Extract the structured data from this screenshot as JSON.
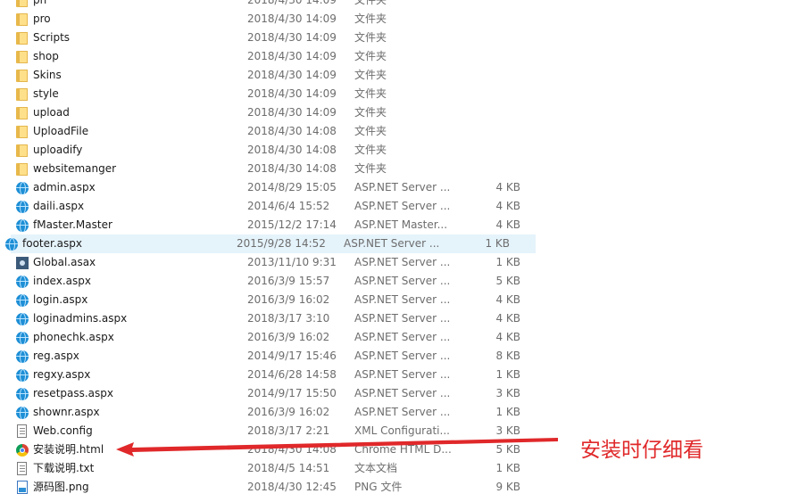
{
  "files": [
    {
      "name": "pn",
      "date": "2018/4/30 14:09",
      "type": "文件夹",
      "size": "",
      "icon": "folder-icon"
    },
    {
      "name": "pro",
      "date": "2018/4/30 14:09",
      "type": "文件夹",
      "size": "",
      "icon": "folder-icon"
    },
    {
      "name": "Scripts",
      "date": "2018/4/30 14:09",
      "type": "文件夹",
      "size": "",
      "icon": "folder-icon"
    },
    {
      "name": "shop",
      "date": "2018/4/30 14:09",
      "type": "文件夹",
      "size": "",
      "icon": "folder-icon"
    },
    {
      "name": "Skins",
      "date": "2018/4/30 14:09",
      "type": "文件夹",
      "size": "",
      "icon": "folder-icon"
    },
    {
      "name": "style",
      "date": "2018/4/30 14:09",
      "type": "文件夹",
      "size": "",
      "icon": "folder-icon"
    },
    {
      "name": "upload",
      "date": "2018/4/30 14:09",
      "type": "文件夹",
      "size": "",
      "icon": "folder-icon"
    },
    {
      "name": "UploadFile",
      "date": "2018/4/30 14:08",
      "type": "文件夹",
      "size": "",
      "icon": "folder-icon"
    },
    {
      "name": "uploadify",
      "date": "2018/4/30 14:08",
      "type": "文件夹",
      "size": "",
      "icon": "folder-icon"
    },
    {
      "name": "websitemanger",
      "date": "2018/4/30 14:08",
      "type": "文件夹",
      "size": "",
      "icon": "folder-icon"
    },
    {
      "name": "admin.aspx",
      "date": "2014/8/29 15:05",
      "type": "ASP.NET Server ...",
      "size": "4 KB",
      "icon": "aspnet-globe-icon"
    },
    {
      "name": "daili.aspx",
      "date": "2014/6/4 15:52",
      "type": "ASP.NET Server ...",
      "size": "4 KB",
      "icon": "aspnet-globe-icon"
    },
    {
      "name": "fMaster.Master",
      "date": "2015/12/2 17:14",
      "type": "ASP.NET Master...",
      "size": "4 KB",
      "icon": "aspnet-globe-icon"
    },
    {
      "name": "footer.aspx",
      "date": "2015/9/28 14:52",
      "type": "ASP.NET Server ...",
      "size": "1 KB",
      "icon": "aspnet-globe-icon",
      "hover": true
    },
    {
      "name": "Global.asax",
      "date": "2013/11/10 9:31",
      "type": "ASP.NET Server ...",
      "size": "1 KB",
      "icon": "config-gear-icon"
    },
    {
      "name": "index.aspx",
      "date": "2016/3/9 15:57",
      "type": "ASP.NET Server ...",
      "size": "5 KB",
      "icon": "aspnet-globe-icon"
    },
    {
      "name": "login.aspx",
      "date": "2016/3/9 16:02",
      "type": "ASP.NET Server ...",
      "size": "4 KB",
      "icon": "aspnet-globe-icon"
    },
    {
      "name": "loginadmins.aspx",
      "date": "2018/3/17 3:10",
      "type": "ASP.NET Server ...",
      "size": "4 KB",
      "icon": "aspnet-globe-icon"
    },
    {
      "name": "phonechk.aspx",
      "date": "2016/3/9 16:02",
      "type": "ASP.NET Server ...",
      "size": "4 KB",
      "icon": "aspnet-globe-icon"
    },
    {
      "name": "reg.aspx",
      "date": "2014/9/17 15:46",
      "type": "ASP.NET Server ...",
      "size": "8 KB",
      "icon": "aspnet-globe-icon"
    },
    {
      "name": "regxy.aspx",
      "date": "2014/6/28 14:58",
      "type": "ASP.NET Server ...",
      "size": "1 KB",
      "icon": "aspnet-globe-icon"
    },
    {
      "name": "resetpass.aspx",
      "date": "2014/9/17 15:50",
      "type": "ASP.NET Server ...",
      "size": "3 KB",
      "icon": "aspnet-globe-icon"
    },
    {
      "name": "shownr.aspx",
      "date": "2016/3/9 16:02",
      "type": "ASP.NET Server ...",
      "size": "1 KB",
      "icon": "aspnet-globe-icon"
    },
    {
      "name": "Web.config",
      "date": "2018/3/17 2:21",
      "type": "XML Configurati...",
      "size": "3 KB",
      "icon": "xml-config-icon"
    },
    {
      "name": "安装说明.html",
      "date": "2018/4/30 14:08",
      "type": "Chrome HTML D...",
      "size": "5 KB",
      "icon": "chrome-icon"
    },
    {
      "name": "下载说明.txt",
      "date": "2018/4/5 14:51",
      "type": "文本文档",
      "size": "1 KB",
      "icon": "text-document-icon"
    },
    {
      "name": "源码图.png",
      "date": "2018/4/30 12:45",
      "type": "PNG 文件",
      "size": "9 KB",
      "icon": "png-image-icon"
    }
  ],
  "annotation": {
    "text": "安装时仔细看",
    "color": "#e0282a"
  }
}
